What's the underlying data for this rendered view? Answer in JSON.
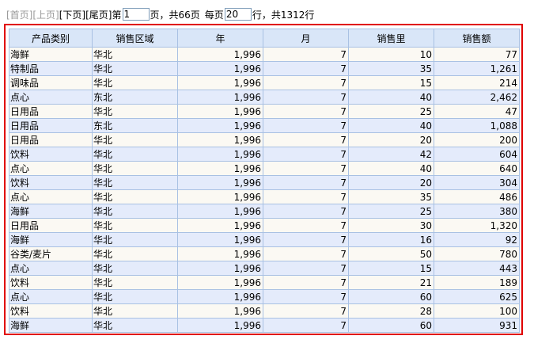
{
  "pager": {
    "first": "[首页]",
    "prev": "[上页]",
    "next": "[下页]",
    "last": "[尾页]",
    "page_prefix": "第",
    "page_value": "1",
    "page_suffix": "页，共66页",
    "per_page_prefix": "每页",
    "per_page_value": "20",
    "per_page_suffix": "行，共1312行"
  },
  "table": {
    "headers": [
      "产品类别",
      "销售区域",
      "年",
      "月",
      "销售里",
      "销售额"
    ],
    "rows": [
      [
        "海鲜",
        "华北",
        "1,996",
        "7",
        "10",
        "77"
      ],
      [
        "特制品",
        "华北",
        "1,996",
        "7",
        "35",
        "1,261"
      ],
      [
        "调味品",
        "华北",
        "1,996",
        "7",
        "15",
        "214"
      ],
      [
        "点心",
        "东北",
        "1,996",
        "7",
        "40",
        "2,462"
      ],
      [
        "日用品",
        "华北",
        "1,996",
        "7",
        "25",
        "47"
      ],
      [
        "日用品",
        "东北",
        "1,996",
        "7",
        "40",
        "1,088"
      ],
      [
        "日用品",
        "华北",
        "1,996",
        "7",
        "20",
        "200"
      ],
      [
        "饮料",
        "华北",
        "1,996",
        "7",
        "42",
        "604"
      ],
      [
        "点心",
        "华北",
        "1,996",
        "7",
        "40",
        "640"
      ],
      [
        "饮料",
        "华北",
        "1,996",
        "7",
        "20",
        "304"
      ],
      [
        "点心",
        "华北",
        "1,996",
        "7",
        "35",
        "486"
      ],
      [
        "海鲜",
        "华北",
        "1,996",
        "7",
        "25",
        "380"
      ],
      [
        "日用品",
        "华北",
        "1,996",
        "7",
        "30",
        "1,320"
      ],
      [
        "海鲜",
        "华北",
        "1,996",
        "7",
        "16",
        "92"
      ],
      [
        "谷类/麦片",
        "华北",
        "1,996",
        "7",
        "50",
        "780"
      ],
      [
        "点心",
        "华北",
        "1,996",
        "7",
        "15",
        "443"
      ],
      [
        "饮料",
        "华北",
        "1,996",
        "7",
        "21",
        "189"
      ],
      [
        "点心",
        "华北",
        "1,996",
        "7",
        "60",
        "625"
      ],
      [
        "饮料",
        "华北",
        "1,996",
        "7",
        "28",
        "100"
      ],
      [
        "海鲜",
        "华北",
        "1,996",
        "7",
        "60",
        "931"
      ]
    ]
  },
  "colors": {
    "frame_border": "#e00000",
    "header_bg": "#d9e6f8",
    "row_odd_bg": "#fbf9f3",
    "row_even_bg": "#e4ebfb",
    "grid_line": "#a9c1e3"
  }
}
